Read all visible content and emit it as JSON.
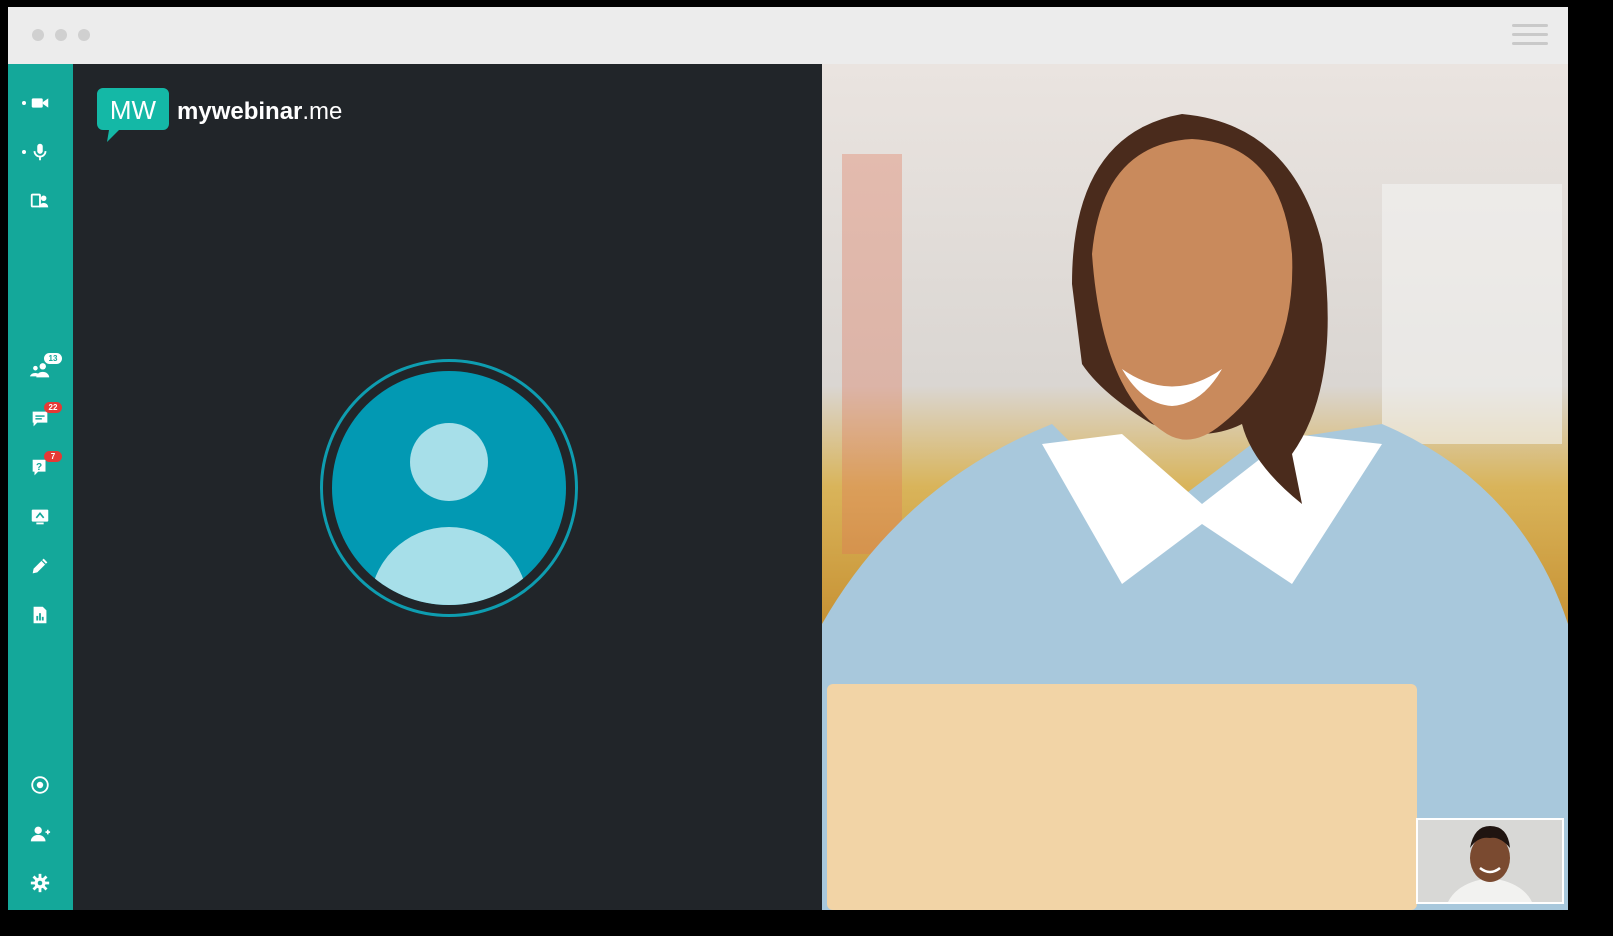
{
  "brand": {
    "name_bold": "mywebinar",
    "name_tld": ".me",
    "logo_letters": "MW"
  },
  "colors": {
    "accent": "#14a89a",
    "stage": "#212529",
    "avatar": "#0299b3",
    "badge_red": "#e53935"
  },
  "sidebar": {
    "top": [
      {
        "icon": "video-camera-icon"
      },
      {
        "icon": "microphone-icon"
      },
      {
        "icon": "contact-card-icon"
      }
    ],
    "middle": [
      {
        "icon": "participants-icon",
        "badge": "13"
      },
      {
        "icon": "chat-icon",
        "badge": "22"
      },
      {
        "icon": "questions-icon",
        "badge": "7"
      },
      {
        "icon": "screen-share-icon"
      },
      {
        "icon": "whiteboard-pen-icon"
      },
      {
        "icon": "poll-report-icon"
      }
    ],
    "bottom": [
      {
        "icon": "record-icon"
      },
      {
        "icon": "add-user-icon"
      },
      {
        "icon": "settings-gear-icon"
      }
    ]
  }
}
